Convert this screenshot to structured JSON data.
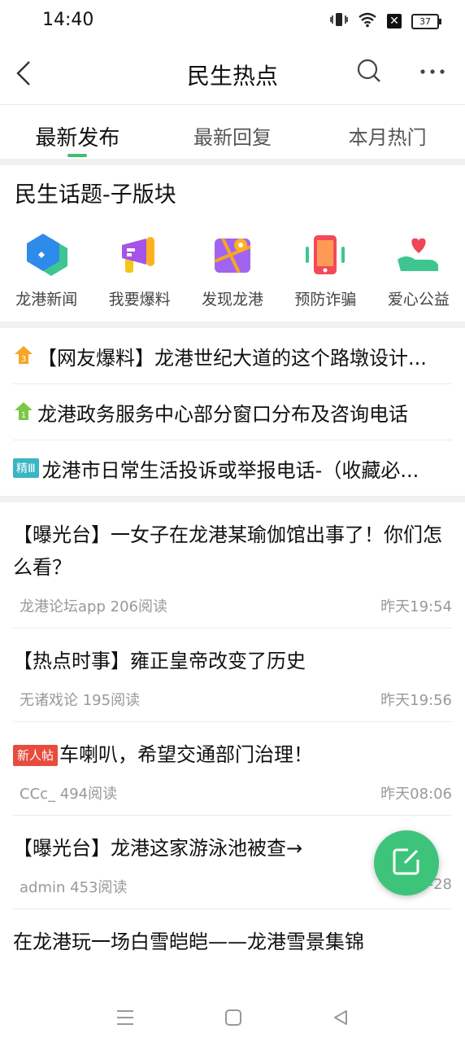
{
  "status": {
    "time": "14:40",
    "battery": "37"
  },
  "nav": {
    "title": "民生热点"
  },
  "tabs": [
    {
      "label": "最新发布",
      "active": true
    },
    {
      "label": "最新回复",
      "active": false
    },
    {
      "label": "本月热门",
      "active": false
    }
  ],
  "section": {
    "title": "民生话题-子版块"
  },
  "subforums": [
    {
      "label": "龙港新闻",
      "icon": "hexagon-icon"
    },
    {
      "label": "我要爆料",
      "icon": "megaphone-icon"
    },
    {
      "label": "发现龙港",
      "icon": "map-pin-icon"
    },
    {
      "label": "预防诈骗",
      "icon": "phone-icon"
    },
    {
      "label": "爱心公益",
      "icon": "heart-hand-icon"
    }
  ],
  "pinned": [
    {
      "badge": "3",
      "badge_color": "#f5a623",
      "text": "【网友爆料】龙港世纪大道的这个路墩设计..."
    },
    {
      "badge": "1",
      "badge_color": "#7ac943",
      "text": "龙港政务服务中心部分窗口分布及咨询电话"
    },
    {
      "badge": "精Ⅲ",
      "badge_color": "#3ab5c4",
      "text": "龙港市日常生活投诉或举报电话-（收藏必..."
    }
  ],
  "posts": [
    {
      "new": "",
      "title": "【曝光台】一女子在龙港某瑜伽馆出事了！你们怎么看？",
      "author": "龙港论坛app",
      "reads": "206阅读",
      "time": "昨天19:54"
    },
    {
      "new": "",
      "title": "【热点时事】雍正皇帝改变了历史",
      "author": "无诸戏论",
      "reads": "195阅读",
      "time": "昨天19:56"
    },
    {
      "new": "新人帖",
      "title": "车喇叭，希望交通部门治理！",
      "author": "CCc_",
      "reads": "494阅读",
      "time": "昨天08:06"
    },
    {
      "new": "",
      "title": "【曝光台】龙港这家游泳池被查→",
      "author": "admin",
      "reads": "453阅读",
      "time": "01-28"
    },
    {
      "new": "",
      "title": "在龙港玩一场白雪皑皑——龙港雪景集锦",
      "author": "",
      "reads": "",
      "time": ""
    }
  ],
  "colors": {
    "accent": "#3dbf72"
  }
}
